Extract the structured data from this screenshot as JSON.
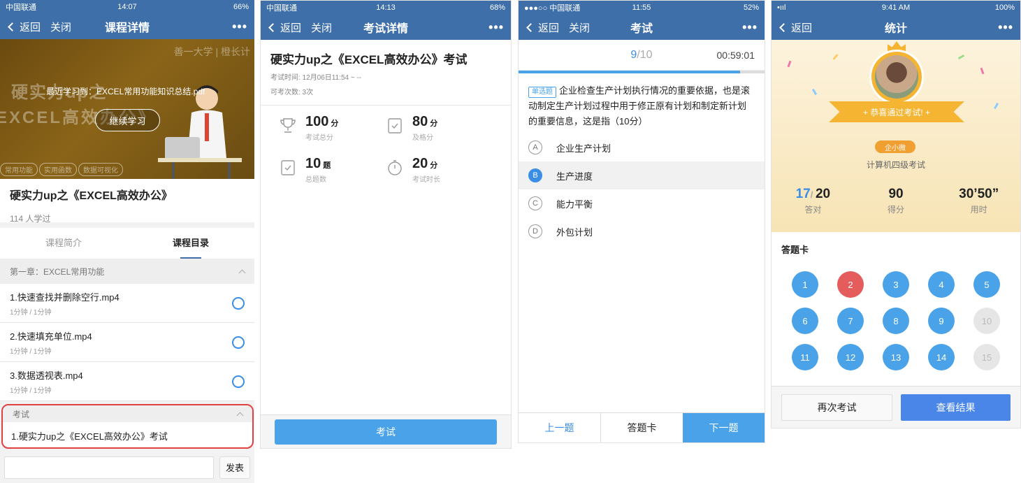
{
  "phone1": {
    "status": {
      "carrier": "中国联通",
      "time": "14:07",
      "battery": "66%"
    },
    "nav": {
      "back": "返回",
      "close": "关闭",
      "title": "课程详情",
      "more": "•••"
    },
    "banner": {
      "big1": "硬实力up之",
      "big2": "EXCEL高效办公》",
      "brand": "善一大学 | 橙长计",
      "recent": "最近学习到：EXCEL常用功能知识总结.pdf",
      "continue": "继续学习",
      "chips": [
        "常用功能",
        "实用函数",
        "数据可视化"
      ]
    },
    "course_title": "硬实力up之《EXCEL高效办公》",
    "learned": "114 人学过",
    "tabs": [
      "课程简介",
      "课程目录"
    ],
    "chapter": "第一章：EXCEL常用功能",
    "lessons": [
      {
        "title": "1.快速查找并删除空行.mp4",
        "sub": "1分钟 / 1分钟"
      },
      {
        "title": "2.快速填充单位.mp4",
        "sub": "1分钟 / 1分钟"
      },
      {
        "title": "3.数据透视表.mp4",
        "sub": "1分钟 / 1分钟"
      }
    ],
    "exam_section": "考试",
    "exam_item": "1.硬实力up之《EXCEL高效办公》考试",
    "send": "发表"
  },
  "phone2": {
    "status": {
      "carrier": "中国联通",
      "time": "14:13",
      "battery": "68%"
    },
    "nav": {
      "back": "返回",
      "close": "关闭",
      "title": "考试详情",
      "more": "•••"
    },
    "exam_title": "硬实力up之《EXCEL高效办公》考试",
    "time_meta": "考试时间: 12月06日11:54 ~ --",
    "attempts": "可考次数: 3次",
    "stats": [
      {
        "num": "100",
        "unit": "分",
        "label": "考试总分"
      },
      {
        "num": "80",
        "unit": "分",
        "label": "及格分"
      },
      {
        "num": "10",
        "unit": "题",
        "label": "总题数"
      },
      {
        "num": "20",
        "unit": "分",
        "label": "考试时长"
      }
    ],
    "button": "考试"
  },
  "phone3": {
    "status": {
      "carrier": "●●●○○ 中国联通",
      "time": "11:55",
      "battery": "52%"
    },
    "nav": {
      "back": "返回",
      "close": "关闭",
      "title": "考试",
      "more": "•••"
    },
    "current": "9",
    "total": "/10",
    "timer": "00:59:01",
    "progress": 0.9,
    "qtag": "单选题",
    "question": "企业检查生产计划执行情况的重要依据，也是滚动制定生产计划过程中用于修正原有计划和制定新计划的重要信息，这是指（10分）",
    "options": [
      {
        "key": "A",
        "text": "企业生产计划"
      },
      {
        "key": "B",
        "text": "生产进度"
      },
      {
        "key": "C",
        "text": "能力平衡"
      },
      {
        "key": "D",
        "text": "外包计划"
      }
    ],
    "footer": {
      "prev": "上一题",
      "card": "答题卡",
      "next": "下一题"
    }
  },
  "phone4": {
    "status": {
      "signal": "•ııl",
      "time": "9:41 AM",
      "battery": "100%"
    },
    "nav": {
      "back": "返回",
      "title": "统计",
      "more": "•••"
    },
    "ribbon": "+ 恭喜通过考试! +",
    "user": "企小微",
    "exam_name": "计算机四级考试",
    "correct": "17",
    "correct_total": "20",
    "correct_label": "答对",
    "score": "90",
    "score_label": "得分",
    "time_used": "30’50”",
    "time_label": "用时",
    "card_title": "答题卡",
    "answers": [
      {
        "n": "1",
        "s": "right"
      },
      {
        "n": "2",
        "s": "wrong"
      },
      {
        "n": "3",
        "s": "right"
      },
      {
        "n": "4",
        "s": "right"
      },
      {
        "n": "5",
        "s": "right"
      },
      {
        "n": "6",
        "s": "right"
      },
      {
        "n": "7",
        "s": "right"
      },
      {
        "n": "8",
        "s": "right"
      },
      {
        "n": "9",
        "s": "right"
      },
      {
        "n": "10",
        "s": "empty"
      },
      {
        "n": "11",
        "s": "right"
      },
      {
        "n": "12",
        "s": "right"
      },
      {
        "n": "13",
        "s": "right"
      },
      {
        "n": "14",
        "s": "right"
      },
      {
        "n": "15",
        "s": "empty"
      }
    ],
    "retry": "再次考试",
    "view": "查看结果"
  }
}
